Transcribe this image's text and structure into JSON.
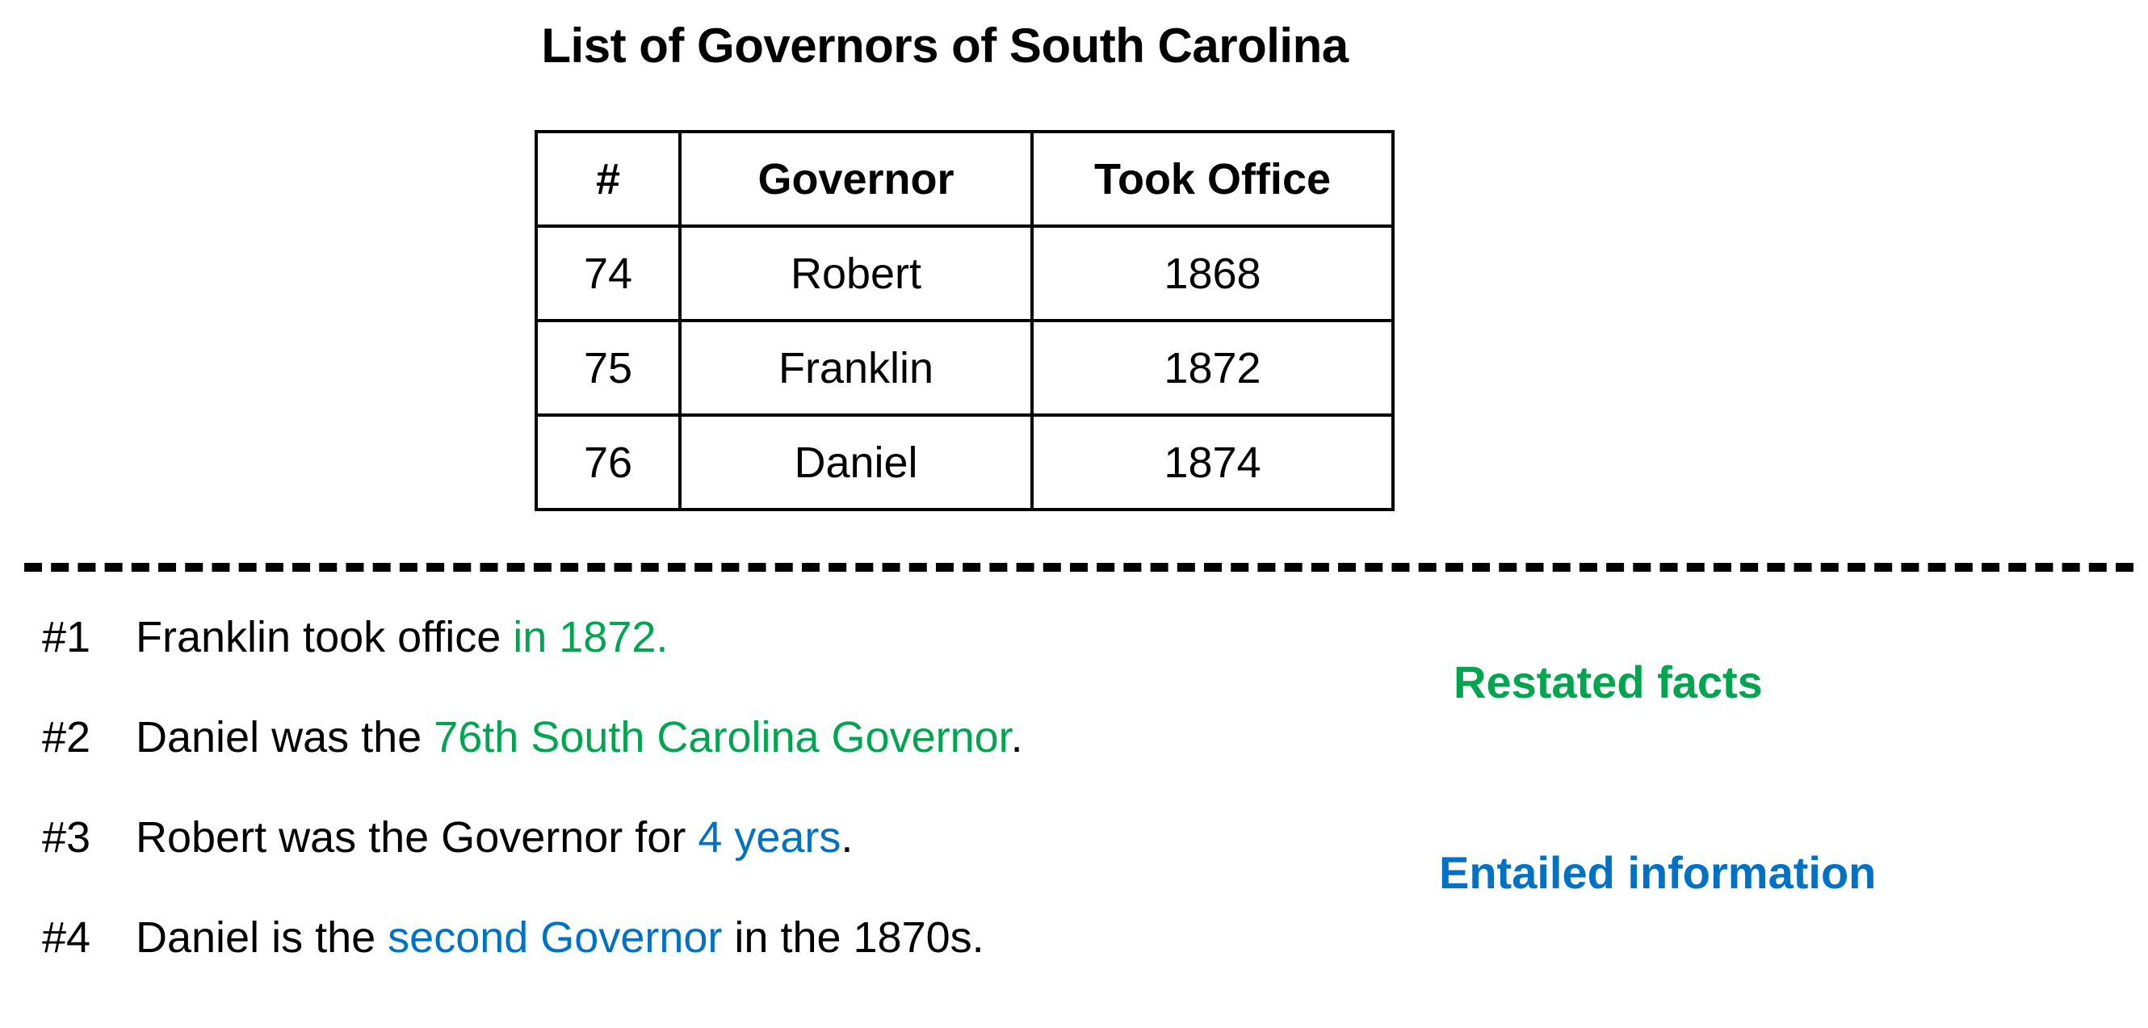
{
  "title": "List of Governors of South Carolina",
  "table": {
    "columns": [
      "#",
      "Governor",
      "Took Office"
    ],
    "rows": [
      {
        "number": "74",
        "governor": "Robert",
        "took_office": "1868"
      },
      {
        "number": "75",
        "governor": "Franklin",
        "took_office": "1872"
      },
      {
        "number": "76",
        "governor": "Daniel",
        "took_office": "1874"
      }
    ]
  },
  "statements": [
    {
      "index": "#1",
      "before": "Franklin took office ",
      "highlight": "in 1872.",
      "after": "",
      "highlight_type": "restated"
    },
    {
      "index": "#2",
      "before": "Daniel was the ",
      "highlight": "76th South Carolina Governor",
      "after": ".",
      "highlight_type": "restated"
    },
    {
      "index": "#3",
      "before": "Robert was the Governor for ",
      "highlight": "4 years",
      "after": ".",
      "highlight_type": "entailed"
    },
    {
      "index": "#4",
      "before": "Daniel is the ",
      "highlight": "second Governor",
      "after": " in the 1870s.",
      "highlight_type": "entailed"
    }
  ],
  "legend": {
    "restated_label": "Restated facts",
    "entailed_label": "Entailed information",
    "restated_color": "#00A550",
    "entailed_color": "#0072C6"
  }
}
